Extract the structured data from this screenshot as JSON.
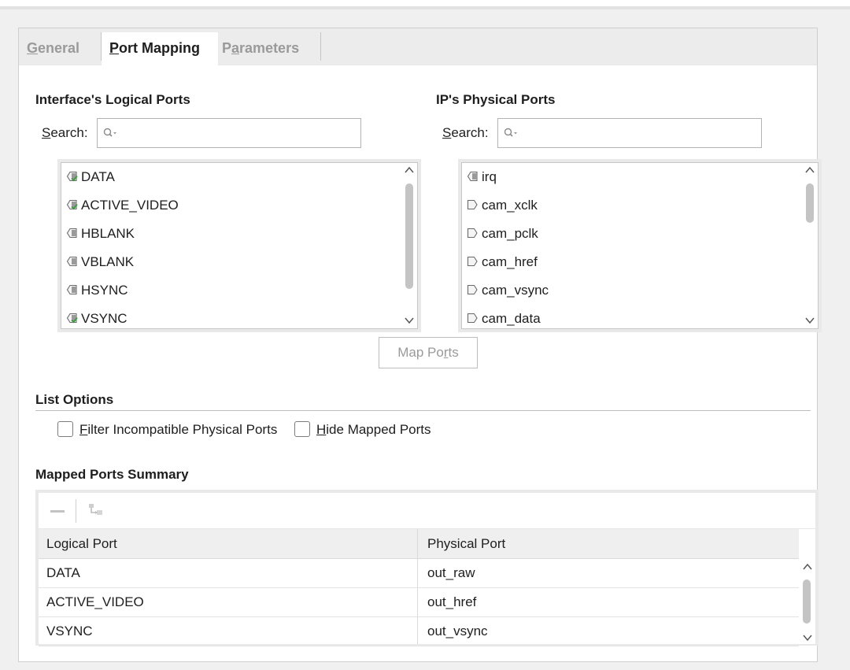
{
  "tabs": [
    {
      "label": "General",
      "underline": "G",
      "rest": "eneral"
    },
    {
      "label": "Port Mapping",
      "underline": "P",
      "rest": "ort Mapping"
    },
    {
      "label": "Parameters",
      "underline": "a",
      "rest": "rameters",
      "prefix": "P"
    }
  ],
  "logical": {
    "title": "Interface's Logical Ports",
    "search_label_u": "S",
    "search_label_rest": "earch:",
    "placeholder": "",
    "items": [
      {
        "name": "DATA",
        "mapped": true
      },
      {
        "name": "ACTIVE_VIDEO",
        "mapped": true
      },
      {
        "name": "HBLANK",
        "mapped": false
      },
      {
        "name": "VBLANK",
        "mapped": false
      },
      {
        "name": "HSYNC",
        "mapped": false
      },
      {
        "name": "VSYNC",
        "mapped": true
      }
    ]
  },
  "physical": {
    "title": "IP's Physical Ports",
    "search_label_u": "S",
    "search_label_rest": "earch:",
    "placeholder": "",
    "items": [
      {
        "name": "irq",
        "direction": "out"
      },
      {
        "name": "cam_xclk",
        "direction": "in"
      },
      {
        "name": "cam_pclk",
        "direction": "in"
      },
      {
        "name": "cam_href",
        "direction": "in"
      },
      {
        "name": "cam_vsync",
        "direction": "in"
      },
      {
        "name": "cam_data",
        "direction": "in"
      }
    ]
  },
  "map_button": {
    "before": "Map Po",
    "underline": "r",
    "after": "ts"
  },
  "list_options": {
    "title": "List Options",
    "filter_u": "F",
    "filter_rest": "ilter Incompatible Physical Ports",
    "hide_u": "H",
    "hide_rest": "ide Mapped Ports"
  },
  "summary": {
    "title": "Mapped Ports Summary",
    "columns": [
      "Logical Port",
      "Physical Port"
    ],
    "rows": [
      [
        "DATA",
        "out_raw"
      ],
      [
        "ACTIVE_VIDEO",
        "out_href"
      ],
      [
        "VSYNC",
        "out_vsync"
      ]
    ]
  },
  "colors": {
    "check_green": "#3a9a3a",
    "port_icon": "#6a6a6a",
    "scroll_thumb": "#c4c4c4"
  }
}
